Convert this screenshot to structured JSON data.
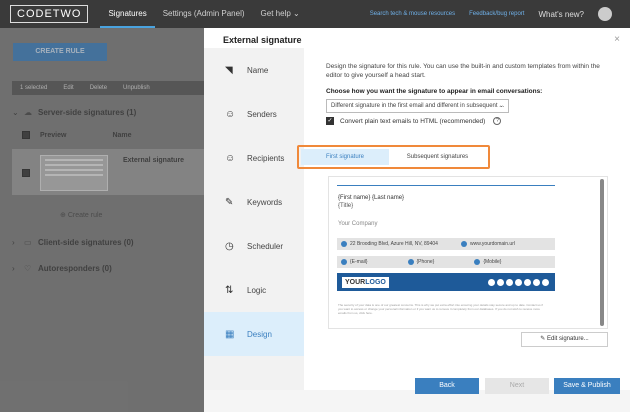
{
  "app": {
    "logo": "CODETWO"
  },
  "nav": [
    {
      "label": "Signatures"
    },
    {
      "label": "Settings (Admin Panel)"
    },
    {
      "label": "Get help ⌄"
    }
  ],
  "topright": {
    "search": "Search tech & mouse resources",
    "feedback": "Feedback/bug report",
    "whatsnew": "What's new?"
  },
  "left": {
    "create_rule": "CREATE RULE",
    "actionbar": [
      "1 selected",
      "Edit",
      "Delete",
      "Unpublish"
    ],
    "groups": {
      "server": "Server-side signatures (1)",
      "client": "Client-side signatures (0)",
      "auto": "Autoresponders (0)"
    },
    "table_headers": {
      "preview": "Preview",
      "name": "Name"
    },
    "row_title": "External signature",
    "add_rule": "Create rule"
  },
  "modal": {
    "title": "External signature",
    "close": "×",
    "steps": [
      {
        "label": "Name",
        "icon": "tag-icon"
      },
      {
        "label": "Senders",
        "icon": "senders-icon"
      },
      {
        "label": "Recipients",
        "icon": "recipients-icon"
      },
      {
        "label": "Keywords",
        "icon": "keywords-icon"
      },
      {
        "label": "Scheduler",
        "icon": "clock-icon"
      },
      {
        "label": "Logic",
        "icon": "logic-icon"
      },
      {
        "label": "Design",
        "icon": "design-icon"
      }
    ],
    "description": "Design the signature for this rule. You can use the built-in and custom templates from within the editor to give yourself a head start.",
    "question": "Choose how you want the signature to appear in email conversations:",
    "select_value": "Different signature in the first email and different in subsequent ...",
    "checkbox_label": "Convert plain text emails to HTML (recommended)",
    "tabs": {
      "first": "First signature",
      "subsequent": "Subsequent signatures"
    },
    "preview": {
      "name": "{First name} {Last name}",
      "title": "{Title}",
      "company": "Your Company",
      "address": "22 Brooding Blvd, Azure Hill, NV, 89404",
      "website": "www.yourdomain.url",
      "email": "{E-mail}",
      "phone": "{Phone}",
      "mobile": "{Mobile}",
      "logo_your": "YOUR",
      "logo_logo": "LOGO",
      "disclaimer": "The security of your data is one of our greatest concerns. This is why we put extra effort into ensuring your details stay secure and up to date. Contact us if you want to access or change your personal information or if you want us to remove it completely from our databases. If you do not wish to receive more emails from us, click here."
    },
    "edit_button": "Edit signature...",
    "buttons": {
      "back": "Back",
      "next": "Next",
      "save": "Save & Publish"
    }
  },
  "colors": {
    "accent": "#3a7fbf",
    "highlight": "#f0893a",
    "topbar": "#3a3a3a"
  }
}
